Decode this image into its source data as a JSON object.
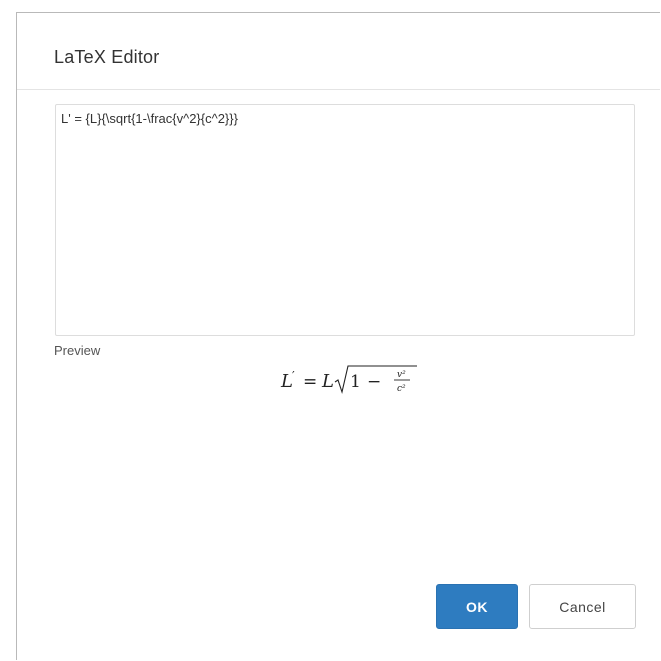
{
  "dialog": {
    "title": "LaTeX Editor"
  },
  "editor": {
    "value": "L' = {L}{\\sqrt{1-\\frac{v^2}{c^2}}}"
  },
  "preview": {
    "label": "Preview",
    "rendered": {
      "lhs": "L",
      "prime": "′",
      "equals": "=",
      "coef": "L",
      "one": "1",
      "minus": "−",
      "num": "v²",
      "den": "c²"
    }
  },
  "buttons": {
    "ok_label": "OK",
    "cancel_label": "Cancel"
  },
  "colors": {
    "primary": "#2e7cc0",
    "border": "#dddddd"
  }
}
